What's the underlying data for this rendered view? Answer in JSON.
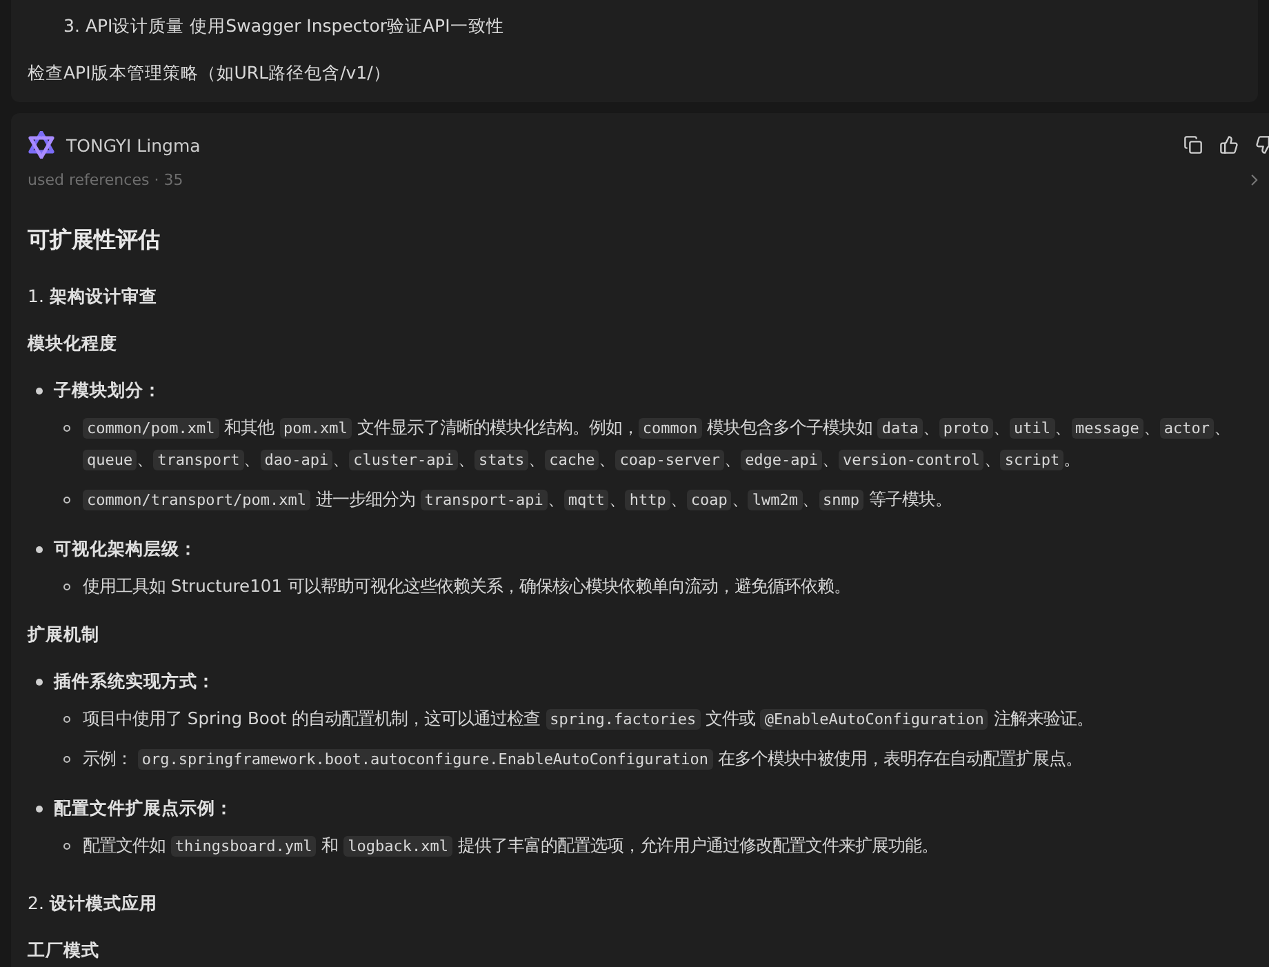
{
  "previous_message": {
    "ordered_item": {
      "number": "3.",
      "text": "API设计质量 使用Swagger Inspector验证API一致性"
    },
    "paragraph": "检查API版本管理策略（如URL路径包含/v1/）"
  },
  "message": {
    "author": "TONGYI Lingma",
    "references": "used references · 35",
    "blocks": [
      {
        "kind": "heading",
        "text": "可扩展性评估"
      },
      {
        "kind": "numbered",
        "text": "1. **架构设计审查**"
      },
      {
        "kind": "subheading",
        "text": "模块化程度"
      },
      {
        "kind": "bullet",
        "text": "子模块划分：",
        "children": [
          [
            {
              "kind": "code",
              "text": "common/pom.xml"
            },
            {
              "kind": "text",
              "text": " 和其他 "
            },
            {
              "kind": "code",
              "text": "pom.xml"
            },
            {
              "kind": "text",
              "text": " 文件显示了清晰的模块化结构。例如，"
            },
            {
              "kind": "code",
              "text": "common"
            },
            {
              "kind": "text",
              "text": " 模块包含多个子模块如 "
            },
            {
              "kind": "code",
              "text": "data"
            },
            {
              "kind": "text",
              "text": "、"
            },
            {
              "kind": "code",
              "text": "proto"
            },
            {
              "kind": "text",
              "text": "、"
            },
            {
              "kind": "code",
              "text": "util"
            },
            {
              "kind": "text",
              "text": "、"
            },
            {
              "kind": "code",
              "text": "message"
            },
            {
              "kind": "text",
              "text": "、"
            },
            {
              "kind": "code",
              "text": "actor"
            },
            {
              "kind": "text",
              "text": "、"
            },
            {
              "kind": "code",
              "text": "queue"
            },
            {
              "kind": "text",
              "text": "、"
            },
            {
              "kind": "code",
              "text": "transport"
            },
            {
              "kind": "text",
              "text": "、"
            },
            {
              "kind": "code",
              "text": "dao-api"
            },
            {
              "kind": "text",
              "text": "、"
            },
            {
              "kind": "code",
              "text": "cluster-api"
            },
            {
              "kind": "text",
              "text": "、"
            },
            {
              "kind": "code",
              "text": "stats"
            },
            {
              "kind": "text",
              "text": "、"
            },
            {
              "kind": "code",
              "text": "cache"
            },
            {
              "kind": "text",
              "text": "、"
            },
            {
              "kind": "code",
              "text": "coap-server"
            },
            {
              "kind": "text",
              "text": "、"
            },
            {
              "kind": "code",
              "text": "edge-api"
            },
            {
              "kind": "text",
              "text": "、"
            },
            {
              "kind": "code",
              "text": "version-control"
            },
            {
              "kind": "text",
              "text": "、"
            },
            {
              "kind": "code",
              "text": "script"
            },
            {
              "kind": "text",
              "text": "。"
            }
          ],
          [
            {
              "kind": "code",
              "text": "common/transport/pom.xml"
            },
            {
              "kind": "text",
              "text": " 进一步细分为 "
            },
            {
              "kind": "code",
              "text": "transport-api"
            },
            {
              "kind": "text",
              "text": "、"
            },
            {
              "kind": "code",
              "text": "mqtt"
            },
            {
              "kind": "text",
              "text": "、"
            },
            {
              "kind": "code",
              "text": "http"
            },
            {
              "kind": "text",
              "text": "、"
            },
            {
              "kind": "code",
              "text": "coap"
            },
            {
              "kind": "text",
              "text": "、"
            },
            {
              "kind": "code",
              "text": "lwm2m"
            },
            {
              "kind": "text",
              "text": "、"
            },
            {
              "kind": "code",
              "text": "snmp"
            },
            {
              "kind": "text",
              "text": " 等子模块。"
            }
          ]
        ]
      },
      {
        "kind": "bullet",
        "text": "可视化架构层级：",
        "children": [
          [
            {
              "kind": "text",
              "text": "使用工具如 Structure101 可以帮助可视化这些依赖关系，确保核心模块依赖单向流动，避免循环依赖。"
            }
          ]
        ]
      },
      {
        "kind": "subheading",
        "text": "扩展机制"
      },
      {
        "kind": "bullet",
        "text": "插件系统实现方式：",
        "children": [
          [
            {
              "kind": "text",
              "text": "项目中使用了 Spring Boot 的自动配置机制，这可以通过检查 "
            },
            {
              "kind": "code",
              "text": "spring.factories"
            },
            {
              "kind": "text",
              "text": " 文件或 "
            },
            {
              "kind": "code",
              "text": "@EnableAutoConfiguration"
            },
            {
              "kind": "text",
              "text": " 注解来验证。"
            }
          ],
          [
            {
              "kind": "text",
              "text": "示例： "
            },
            {
              "kind": "code",
              "text": "org.springframework.boot.autoconfigure.EnableAutoConfiguration"
            },
            {
              "kind": "text",
              "text": " 在多个模块中被使用，表明存在自动配置扩展点。"
            }
          ]
        ]
      },
      {
        "kind": "bullet",
        "text": "配置文件扩展点示例：",
        "children": [
          [
            {
              "kind": "text",
              "text": "配置文件如 "
            },
            {
              "kind": "code",
              "text": "thingsboard.yml"
            },
            {
              "kind": "text",
              "text": " 和 "
            },
            {
              "kind": "code",
              "text": "logback.xml"
            },
            {
              "kind": "text",
              "text": " 提供了丰富的配置选项，允许用户通过修改配置文件来扩展功能。"
            }
          ]
        ]
      },
      {
        "kind": "numbered",
        "text": "2. **设计模式应用**"
      },
      {
        "kind": "subheading",
        "text": "工厂模式"
      }
    ]
  }
}
